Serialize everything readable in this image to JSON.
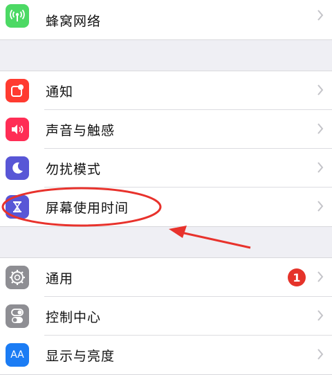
{
  "group1": [
    {
      "label": "蜂窝网络",
      "icon": "cellular-icon",
      "color": "#4cd964"
    }
  ],
  "group2": [
    {
      "label": "通知",
      "icon": "notifications-icon",
      "color": "#ff3b30"
    },
    {
      "label": "声音与触感",
      "icon": "sound-icon",
      "color": "#ff2d55"
    },
    {
      "label": "勿扰模式",
      "icon": "moon-icon",
      "color": "#5856d6"
    },
    {
      "label": "屏幕使用时间",
      "icon": "hourglass-icon",
      "color": "#5856d6"
    }
  ],
  "group3": [
    {
      "label": "通用",
      "icon": "gear-icon",
      "color": "#8e8e93",
      "badge": "1"
    },
    {
      "label": "控制中心",
      "icon": "toggles-icon",
      "color": "#8e8e93"
    },
    {
      "label": "显示与亮度",
      "icon": "display-icon",
      "color": "#1b7cf4",
      "icon_text": "AA"
    }
  ],
  "colors": {
    "annotation": "#e8322c"
  }
}
